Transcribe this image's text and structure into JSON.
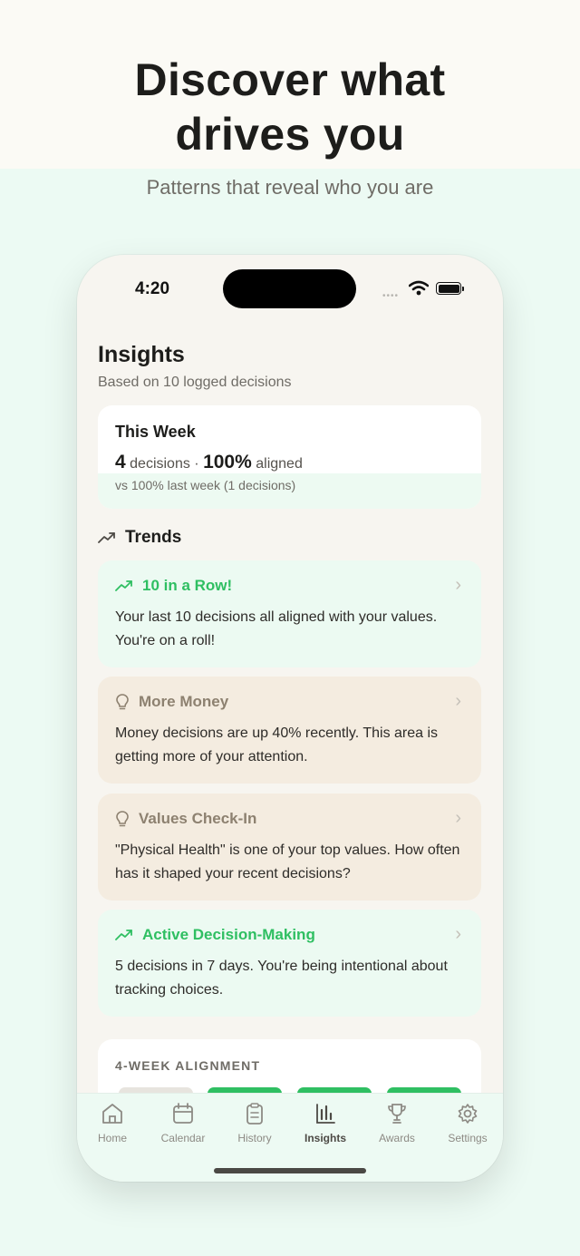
{
  "hero": {
    "headline_line1": "Discover what",
    "headline_line2": "drives you",
    "subhead": "Patterns that reveal who you are"
  },
  "status_bar": {
    "time": "4:20",
    "dots": "••••"
  },
  "page": {
    "title": "Insights",
    "subtitle": "Based on 10 logged decisions"
  },
  "this_week": {
    "title": "This Week",
    "decisions_count": "4",
    "decisions_label": "decisions",
    "separator": "·",
    "aligned_pct": "100%",
    "aligned_label": "aligned",
    "comparison": "vs 100% last week (1 decisions)"
  },
  "trends": {
    "label": "Trends",
    "cards": [
      {
        "kind": "green",
        "icon": "trending-up-icon",
        "title": "10 in a Row!",
        "body": "Your last 10 decisions all aligned with your values. You're on a roll!"
      },
      {
        "kind": "tan",
        "icon": "lightbulb-icon",
        "title": "More Money",
        "body": "Money decisions are up 40% recently. This area is getting more of your attention."
      },
      {
        "kind": "tan",
        "icon": "lightbulb-icon",
        "title": "Values Check-In",
        "body": "\"Physical Health\" is one of your top values. How often has it shaped your recent decisions?"
      },
      {
        "kind": "green",
        "icon": "trending-up-icon",
        "title": "Active Decision-Making",
        "body": "5 decisions in 7 days. You're being intentional about tracking choices."
      }
    ]
  },
  "alignment": {
    "title": "4-WEEK ALIGNMENT"
  },
  "tabs": [
    {
      "label": "Home",
      "icon": "home-icon",
      "active": false
    },
    {
      "label": "Calendar",
      "icon": "calendar-icon",
      "active": false
    },
    {
      "label": "History",
      "icon": "clipboard-icon",
      "active": false
    },
    {
      "label": "Insights",
      "icon": "bar-chart-icon",
      "active": true
    },
    {
      "label": "Awards",
      "icon": "trophy-icon",
      "active": false
    },
    {
      "label": "Settings",
      "icon": "gear-icon",
      "active": false
    }
  ],
  "colors": {
    "accent_green": "#2fbf62",
    "tan_text": "#8d8170",
    "bar_gray": "#e7e4de"
  }
}
